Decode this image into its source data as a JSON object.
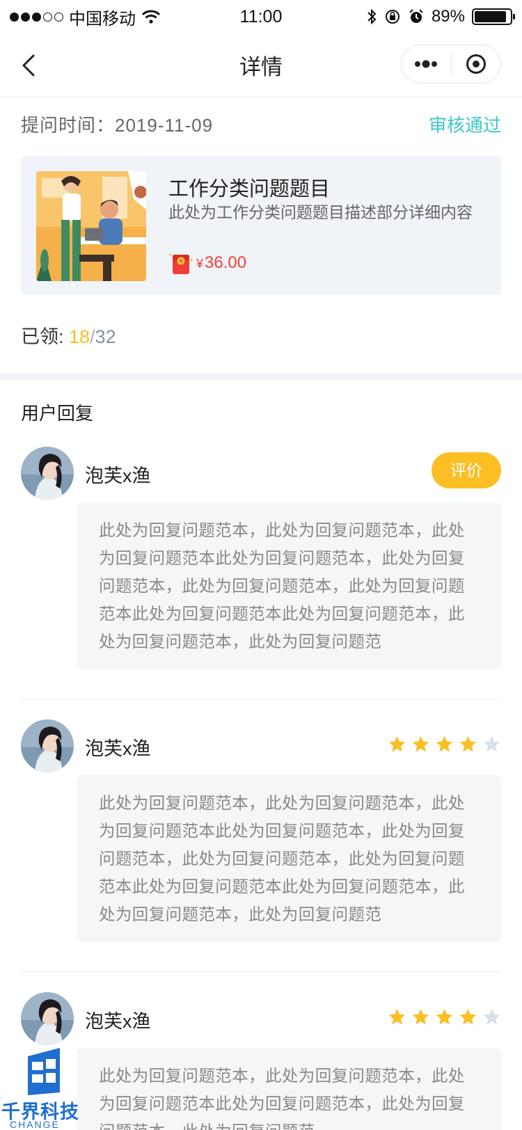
{
  "status_bar": {
    "carrier": "中国移动",
    "time": "11:00",
    "battery_percent": "89%",
    "battery_level": 0.89
  },
  "nav": {
    "title": "详情"
  },
  "question": {
    "time_label": "提问时间：2019-11-09",
    "status": "审核通过",
    "title": "工作分类问题题目",
    "description": "此处为工作分类问题题目描述部分详细内容",
    "currency": "¥",
    "price": "36.00"
  },
  "claimed": {
    "label": "已领: ",
    "count": "18",
    "separator": "/",
    "total": "32"
  },
  "section_title": "用户回复",
  "replies": [
    {
      "name": "泡芙x渔",
      "action_label": "评价",
      "rating": null,
      "text": "此处为回复问题范本，此处为回复问题范本，此处为回复问题范本此处为回复问题范本，此处为回复问题范本，此处为回复问题范本，此处为回复问题范本此处为回复问题范本此处为回复问题范本，此处为回复问题范本，此处为回复问题范"
    },
    {
      "name": "泡芙x渔",
      "rating": 4,
      "rating_max": 5,
      "text": "此处为回复问题范本，此处为回复问题范本，此处为回复问题范本此处为回复问题范本，此处为回复问题范本，此处为回复问题范本，此处为回复问题范本此处为回复问题范本此处为回复问题范本，此处为回复问题范本，此处为回复问题范"
    },
    {
      "name": "泡芙x渔",
      "rating": 4,
      "rating_max": 5,
      "text": "此处为回复问题范本，此处为回复问题范本，此处为回复问题范本此处为回复问题范本，此处为回复问题范本，此处为回复问题范"
    }
  ],
  "watermark": {
    "text": "千界科技",
    "subtext": "CHANGE"
  },
  "colors": {
    "accent_yellow": "#fbbf24",
    "status_teal": "#3ec6c6",
    "price_red": "#f0423b",
    "star_off": "#d7e1ea"
  }
}
